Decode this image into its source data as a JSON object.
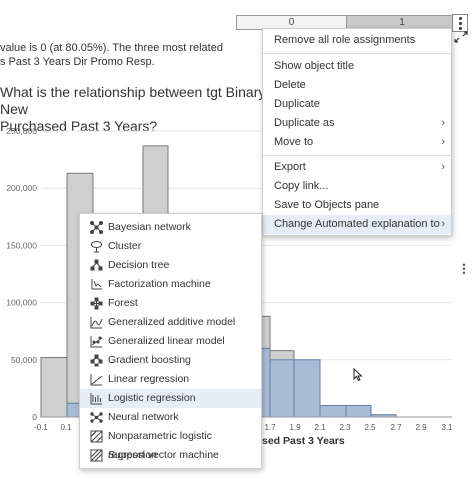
{
  "toggle": {
    "left_label": "0",
    "right_label": "1"
  },
  "summary": {
    "line1": "value is 0 (at 80.05%). The three most related",
    "line2": "s Past 3 Years Dir Promo Resp."
  },
  "chart_title": {
    "line1": "What is the relationship between tgt Binary New",
    "line2": "Purchased Past 3 Years?"
  },
  "chart_data": {
    "type": "bar",
    "y_ticks": [
      "250,000",
      "200,000",
      "150,000",
      "100,000",
      "50,000",
      "0"
    ],
    "x_ticks": [
      "-0.1",
      "0.1",
      "1.7",
      "1.9",
      "2.1",
      "2.3",
      "2.5",
      "2.7",
      "2.9",
      "3.1"
    ],
    "xlabel_fragment": "sed Past 3 Years",
    "ylim": [
      0,
      250000
    ],
    "colors": {
      "series_0": "#cfcfcf",
      "series_1": "#a8bcd6"
    }
  },
  "context_menu": {
    "items": [
      {
        "label": "Remove all role assignments",
        "submenu": false
      },
      {
        "label": "Show object title",
        "submenu": false
      },
      {
        "label": "Delete",
        "submenu": false
      },
      {
        "label": "Duplicate",
        "submenu": false
      },
      {
        "label": "Duplicate as",
        "submenu": true
      },
      {
        "label": "Move to",
        "submenu": true
      },
      {
        "label": "Export",
        "submenu": true
      },
      {
        "label": "Copy link...",
        "submenu": false
      },
      {
        "label": "Save to Objects pane",
        "submenu": false
      },
      {
        "label": "Change Automated explanation to",
        "submenu": true,
        "highlighted": true
      }
    ],
    "arrow_glyph": "›"
  },
  "submenu": {
    "items": [
      {
        "label": "Bayesian network",
        "icon": "bayesian-network-icon"
      },
      {
        "label": "Cluster",
        "icon": "cluster-icon"
      },
      {
        "label": "Decision tree",
        "icon": "decision-tree-icon"
      },
      {
        "label": "Factorization machine",
        "icon": "factorization-machine-icon"
      },
      {
        "label": "Forest",
        "icon": "forest-icon"
      },
      {
        "label": "Generalized additive model",
        "icon": "generalized-additive-model-icon"
      },
      {
        "label": "Generalized linear model",
        "icon": "generalized-linear-model-icon"
      },
      {
        "label": "Gradient boosting",
        "icon": "gradient-boosting-icon"
      },
      {
        "label": "Linear regression",
        "icon": "linear-regression-icon"
      },
      {
        "label": "Logistic regression",
        "icon": "logistic-regression-icon",
        "highlighted": true
      },
      {
        "label": "Neural network",
        "icon": "neural-network-icon"
      },
      {
        "label": "Nonparametric logistic regression",
        "icon": "nonparametric-logistic-regression-icon"
      },
      {
        "label": "Support vector machine",
        "icon": "support-vector-machine-icon"
      }
    ]
  }
}
